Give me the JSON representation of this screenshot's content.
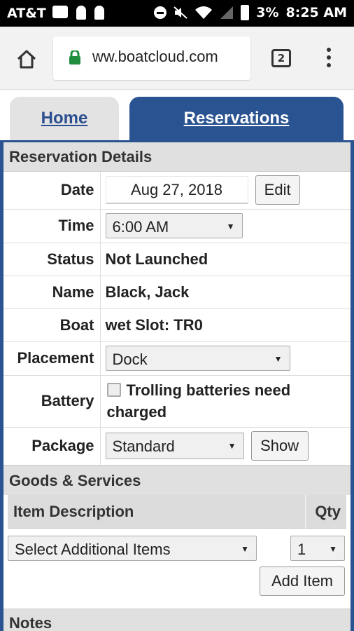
{
  "status_bar": {
    "carrier": "AT&T",
    "battery": "3%",
    "time": "8:25 AM"
  },
  "browser": {
    "url": "ww.boatcloud.com",
    "tab_count": "2"
  },
  "nav_tabs": [
    {
      "label": "Home"
    },
    {
      "label": "Reservations"
    }
  ],
  "reservation": {
    "header": "Reservation Details",
    "date": {
      "label": "Date",
      "value": "Aug 27, 2018",
      "button": "Edit"
    },
    "time": {
      "label": "Time",
      "value": "6:00 AM"
    },
    "status": {
      "label": "Status",
      "value": "Not Launched"
    },
    "name": {
      "label": "Name",
      "value": "Black, Jack"
    },
    "boat": {
      "label": "Boat",
      "value": "wet Slot: TR0"
    },
    "placement": {
      "label": "Placement",
      "value": "Dock"
    },
    "battery": {
      "label": "Battery",
      "checkbox_label": "Trolling batteries need charged",
      "checked": false
    },
    "package": {
      "label": "Package",
      "value": "Standard",
      "button": "Show"
    }
  },
  "goods_services": {
    "header": "Goods & Services",
    "columns": [
      "Item Description",
      "Qty"
    ],
    "item_select": "Select Additional Items",
    "qty_select": "1",
    "add_button": "Add Item"
  },
  "notes": {
    "header": "Notes"
  }
}
